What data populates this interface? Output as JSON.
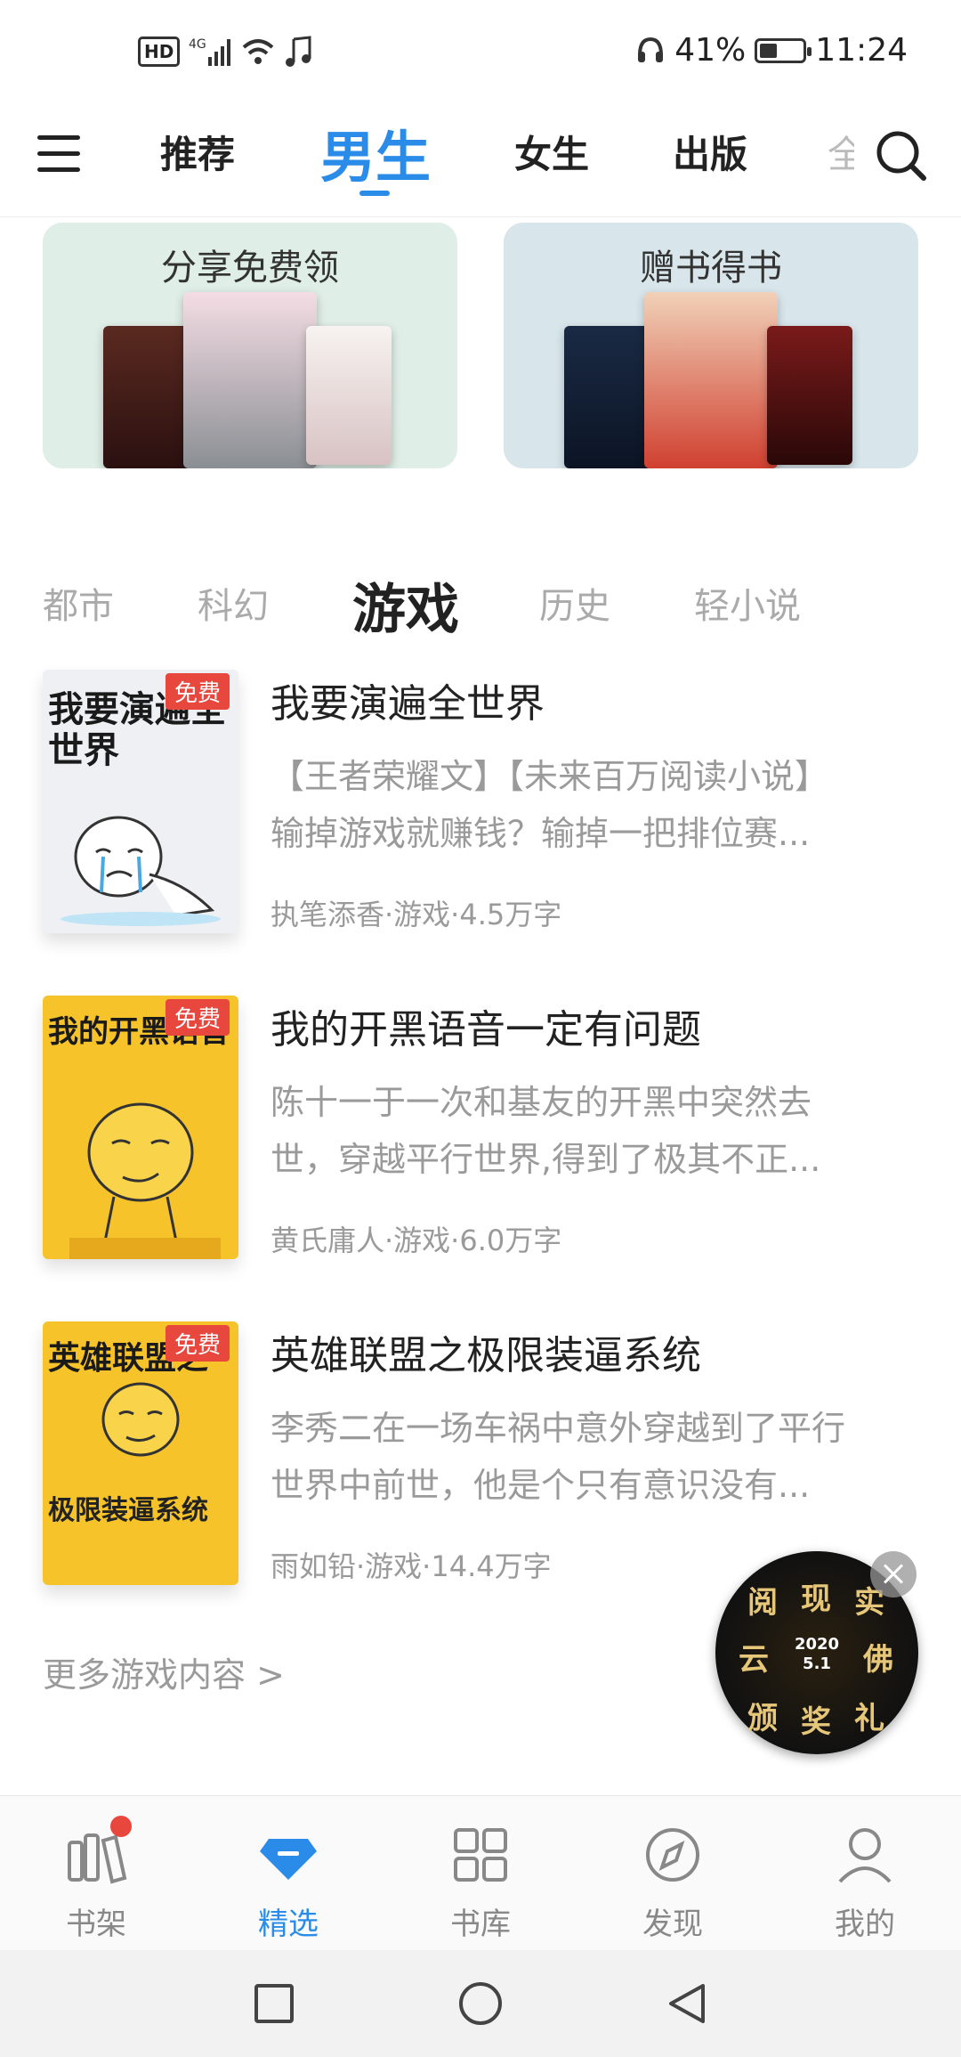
{
  "status_bar": {
    "hd": "HD",
    "network": "4G",
    "headset_battery": "41%",
    "battery_level": 0.41,
    "time": "11:24"
  },
  "nav": {
    "tabs": [
      {
        "label": "推荐",
        "active": false
      },
      {
        "label": "男生",
        "active": true
      },
      {
        "label": "女生",
        "active": false
      },
      {
        "label": "出版",
        "active": false
      }
    ],
    "partial_tab": "全"
  },
  "promos": [
    {
      "title": "分享免费领",
      "color": "#dfeee7"
    },
    {
      "title": "赠书得书",
      "color": "#d8e6ec"
    }
  ],
  "categories": [
    {
      "label": "都市",
      "active": false
    },
    {
      "label": "科幻",
      "active": false
    },
    {
      "label": "游戏",
      "active": true
    },
    {
      "label": "历史",
      "active": false
    },
    {
      "label": "轻小说",
      "active": false
    }
  ],
  "books": [
    {
      "title": "我要演遍全世界",
      "desc_line1": "【王者荣耀文】【未来百万阅读小说】",
      "desc_line2": "输掉游戏就赚钱？输掉一把排位赛...",
      "meta": "执笔添香·游戏·4.5万字",
      "badge": "免费",
      "cover_text": "我要演遍全世界",
      "cover_color": "#eef0f4"
    },
    {
      "title": "我的开黑语音一定有问题",
      "desc_line1": "陈十一于一次和基友的开黑中突然去",
      "desc_line2": "世，穿越平行世界,得到了极其不正...",
      "meta": "黄氏庸人·游戏·6.0万字",
      "badge": "免费",
      "cover_text": "我的开黑语音",
      "cover_color": "#f6c42a"
    },
    {
      "title": "英雄联盟之极限装逼系统",
      "desc_line1": "李秀二在一场车祸中意外穿越到了平行",
      "desc_line2": "世界中前世，他是个只有意识没有...",
      "meta": "雨如铅·游戏·14.4万字",
      "badge": "免费",
      "cover_text": "英雄联盟之",
      "cover_text2": "极限装逼系统",
      "cover_color": "#f6c42a"
    }
  ],
  "more_link": "更多游戏内容 >",
  "float_badge": {
    "chars": [
      "阅",
      "现",
      "实",
      "云",
      "佛",
      "颁",
      "奖",
      "礼"
    ],
    "year": "2020",
    "date": "5.1"
  },
  "bottom_tabs": [
    {
      "label": "书架",
      "icon": "bookshelf-icon"
    },
    {
      "label": "精选",
      "icon": "diamond-icon",
      "active": true
    },
    {
      "label": "书库",
      "icon": "grid-icon"
    },
    {
      "label": "发现",
      "icon": "compass-icon"
    },
    {
      "label": "我的",
      "icon": "person-icon"
    }
  ],
  "colors": {
    "accent": "#2a8ce8",
    "badge_red": "#e8473e",
    "muted_text": "#9a9a9a"
  }
}
